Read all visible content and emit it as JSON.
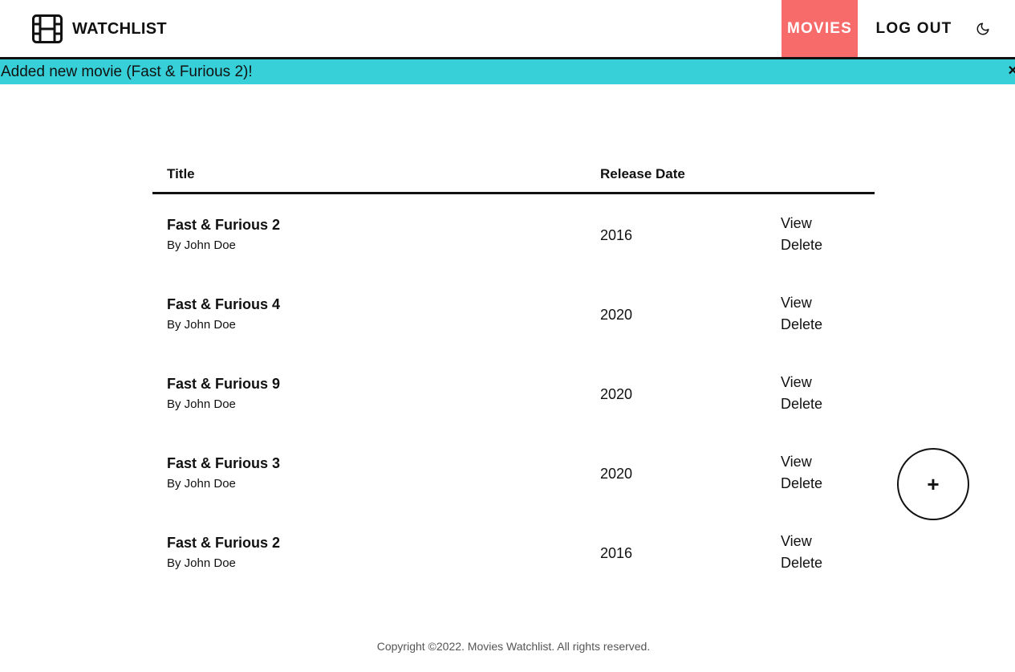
{
  "brand": {
    "title": "WATCHLIST",
    "icon": "film-icon"
  },
  "nav": {
    "movies_label": "MOVIES",
    "logout_label": "LOG OUT",
    "theme_icon": "moon-icon",
    "active_color": "#f76b6b"
  },
  "alert": {
    "message": "Added new movie (Fast & Furious 2)!",
    "close_label": "×",
    "color": "#37d0d8"
  },
  "table": {
    "headers": {
      "title": "Title",
      "release_date": "Release Date"
    },
    "rows": [
      {
        "title": "Fast & Furious 2",
        "author": "By John Doe",
        "release": "2016",
        "view": "View",
        "delete": "Delete"
      },
      {
        "title": "Fast & Furious 4",
        "author": "By John Doe",
        "release": "2020",
        "view": "View",
        "delete": "Delete"
      },
      {
        "title": "Fast & Furious 9",
        "author": "By John Doe",
        "release": "2020",
        "view": "View",
        "delete": "Delete"
      },
      {
        "title": "Fast & Furious 3",
        "author": "By John Doe",
        "release": "2020",
        "view": "View",
        "delete": "Delete"
      },
      {
        "title": "Fast & Furious 2",
        "author": "By John Doe",
        "release": "2016",
        "view": "View",
        "delete": "Delete"
      }
    ]
  },
  "fab": {
    "label": "+"
  },
  "footer": {
    "text": "Copyright ©2022. Movies Watchlist. All rights reserved."
  }
}
